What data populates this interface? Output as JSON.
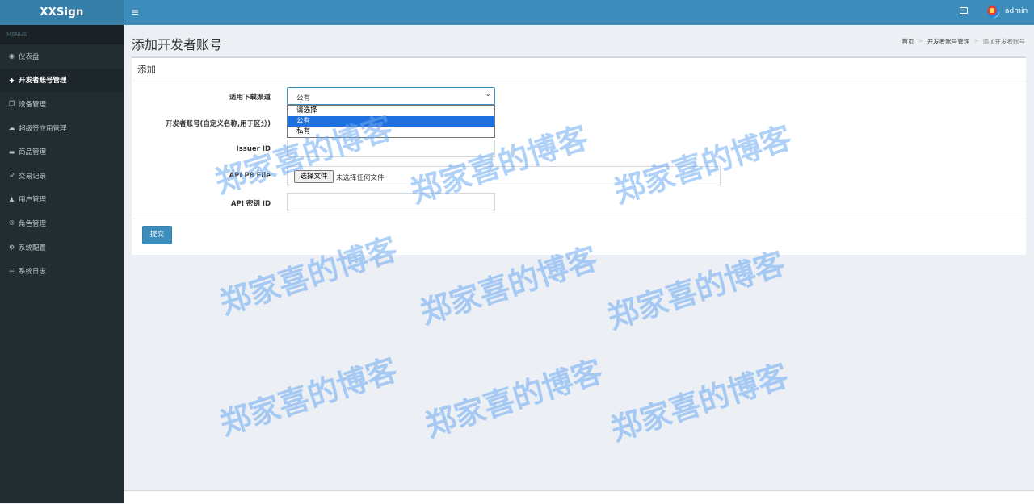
{
  "app": {
    "brand": "XXSign"
  },
  "sidebar": {
    "header": "MENUS",
    "items": [
      {
        "label": "仪表盘",
        "icon": "dashboard-icon",
        "glyph": "◉"
      },
      {
        "label": "开发者账号管理",
        "icon": "tag-icon",
        "glyph": "◆"
      },
      {
        "label": "设备管理",
        "icon": "copy-icon",
        "glyph": "❐"
      },
      {
        "label": "超级签应用管理",
        "icon": "comments-icon",
        "glyph": "☁"
      },
      {
        "label": "商品管理",
        "icon": "keyboard-icon",
        "glyph": "▬"
      },
      {
        "label": "交易记录",
        "icon": "rouble-icon",
        "glyph": "₽"
      },
      {
        "label": "用户管理",
        "icon": "user-icon",
        "glyph": "♟"
      },
      {
        "label": "角色管理",
        "icon": "registered-icon",
        "glyph": "®"
      },
      {
        "label": "系统配置",
        "icon": "gear-icon",
        "glyph": "⚙"
      },
      {
        "label": "系统日志",
        "icon": "list-icon",
        "glyph": "☰"
      }
    ],
    "active_index": 1
  },
  "header": {
    "menu_toggle": "≡",
    "user": "admin"
  },
  "page": {
    "title": "添加开发者账号",
    "breadcrumb": [
      "首页",
      "开发者账号管理",
      "添加开发者账号"
    ],
    "breadcrumb_sep": ">"
  },
  "form": {
    "box_title": "添加",
    "channel_label": "适用下载渠道",
    "channel_value": "公有",
    "channel_arrow": "⌄",
    "channel_options": [
      "请选择",
      "公有",
      "私有"
    ],
    "channel_selected_index": 1,
    "account_label": "开发者账号(自定义名称,用于区分)",
    "issuer_label": "Issuer ID",
    "p8_label": "API P8 File",
    "file_button": "选择文件",
    "file_none": "未选择任何文件",
    "key_label": "API 密钥 ID",
    "submit": "提交"
  },
  "watermark": "郑家喜的博客",
  "colors": {
    "primary": "#3c8dbc",
    "sidebar": "#222d32",
    "watermark": "#6eaaf0"
  }
}
